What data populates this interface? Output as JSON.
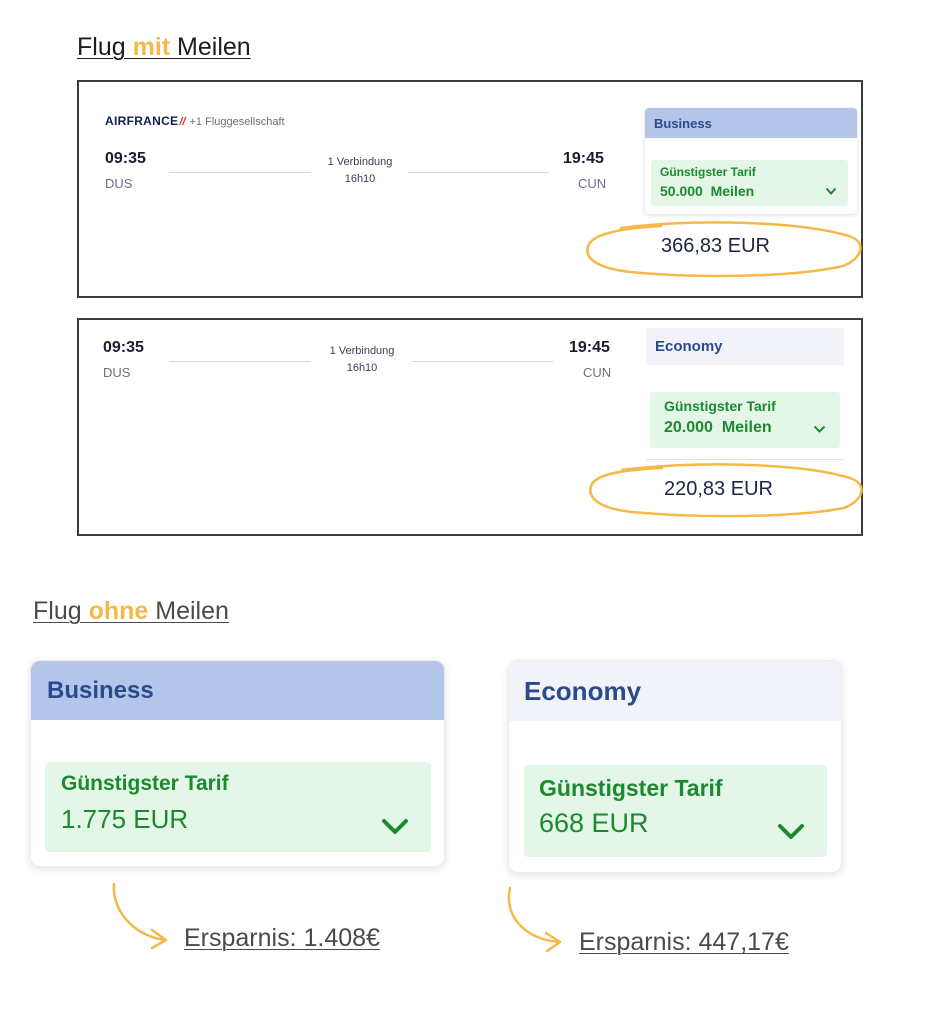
{
  "section_with_miles": {
    "heading_before": "Flug ",
    "heading_highlight": "mit",
    "heading_after": " Meilen"
  },
  "flight_business": {
    "airline_logo": "AIRFRANCE",
    "airline_extra": "+1 Fluggesellschaft",
    "departure_time": "09:35",
    "departure_code": "DUS",
    "connection": "1 Verbindung",
    "duration": "16h10",
    "arrival_time": "19:45",
    "arrival_code": "CUN",
    "cabin": "Business",
    "fare_label": "Günstigster Tarif",
    "miles": "50.000",
    "miles_unit": "Meilen",
    "price": "366,83 EUR"
  },
  "flight_economy": {
    "departure_time": "09:35",
    "departure_code": "DUS",
    "connection": "1 Verbindung",
    "duration": "16h10",
    "arrival_time": "19:45",
    "arrival_code": "CUN",
    "cabin": "Economy",
    "fare_label": "Günstigster Tarif",
    "miles": "20.000",
    "miles_unit": "Meilen",
    "price": "220,83 EUR"
  },
  "section_without_miles": {
    "heading_before": "Flug ",
    "heading_highlight": "ohne",
    "heading_after": " Meilen"
  },
  "fare_business": {
    "cabin": "Business",
    "fare_label": "Günstigster Tarif",
    "price": "1.775 EUR",
    "savings": "Ersparnis: 1.408€"
  },
  "fare_economy": {
    "cabin": "Economy",
    "fare_label": "Günstigster Tarif",
    "price": "668 EUR",
    "savings": "Ersparnis: 447,17€"
  },
  "colors": {
    "highlight": "#f5b94a",
    "business_header": "#b3c6ea",
    "economy_header": "#f1f3f9",
    "fare_green_bg": "#e4f6e7",
    "fare_green_text": "#1b8a2e",
    "header_blue_text": "#2a4a8c"
  }
}
